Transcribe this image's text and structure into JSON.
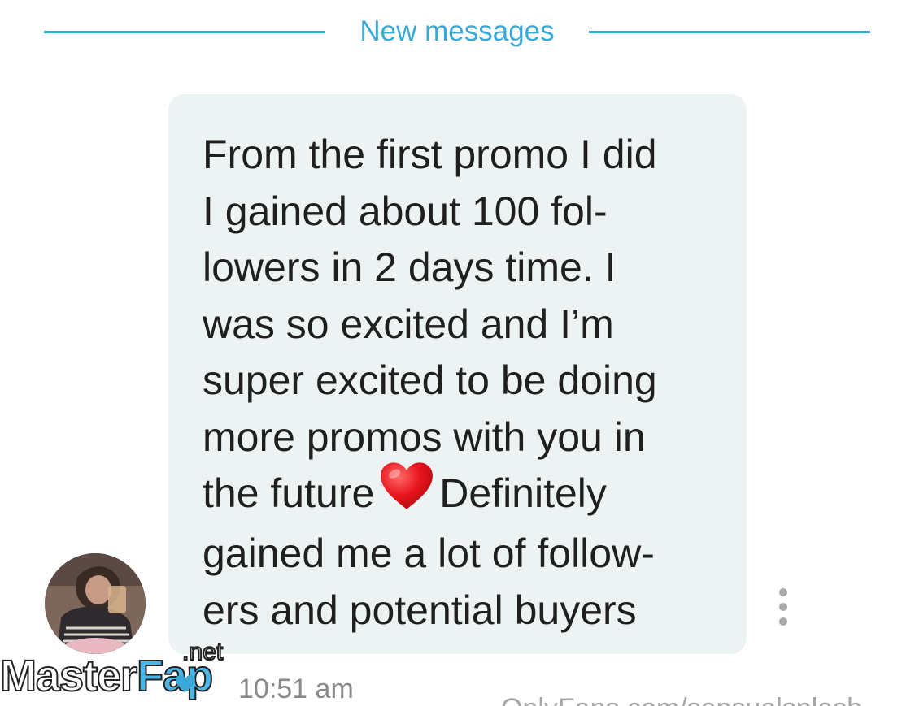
{
  "colors": {
    "accent": "#3aa9d8",
    "bubble": "#edf2f2"
  },
  "divider": {
    "label": "New messages"
  },
  "message": {
    "lines": [
      "From the first promo I did",
      "I gained about 100 fol-",
      "lowers in 2 days time. I",
      "was so excited and I’m",
      "super excited to be doing",
      "more promos with you in"
    ],
    "line7_before": "the future",
    "line7_after": "Definitely",
    "line8": "gained me a lot of follow-",
    "line9": "ers and potential buyers",
    "emoji_icon": "red-heart-icon",
    "timestamp": "10:51 am"
  },
  "footer": {
    "profile_url": "OnlyFans.com/sensualsplash"
  },
  "watermark": {
    "text": "MasterFap",
    "suffix": ".net"
  }
}
